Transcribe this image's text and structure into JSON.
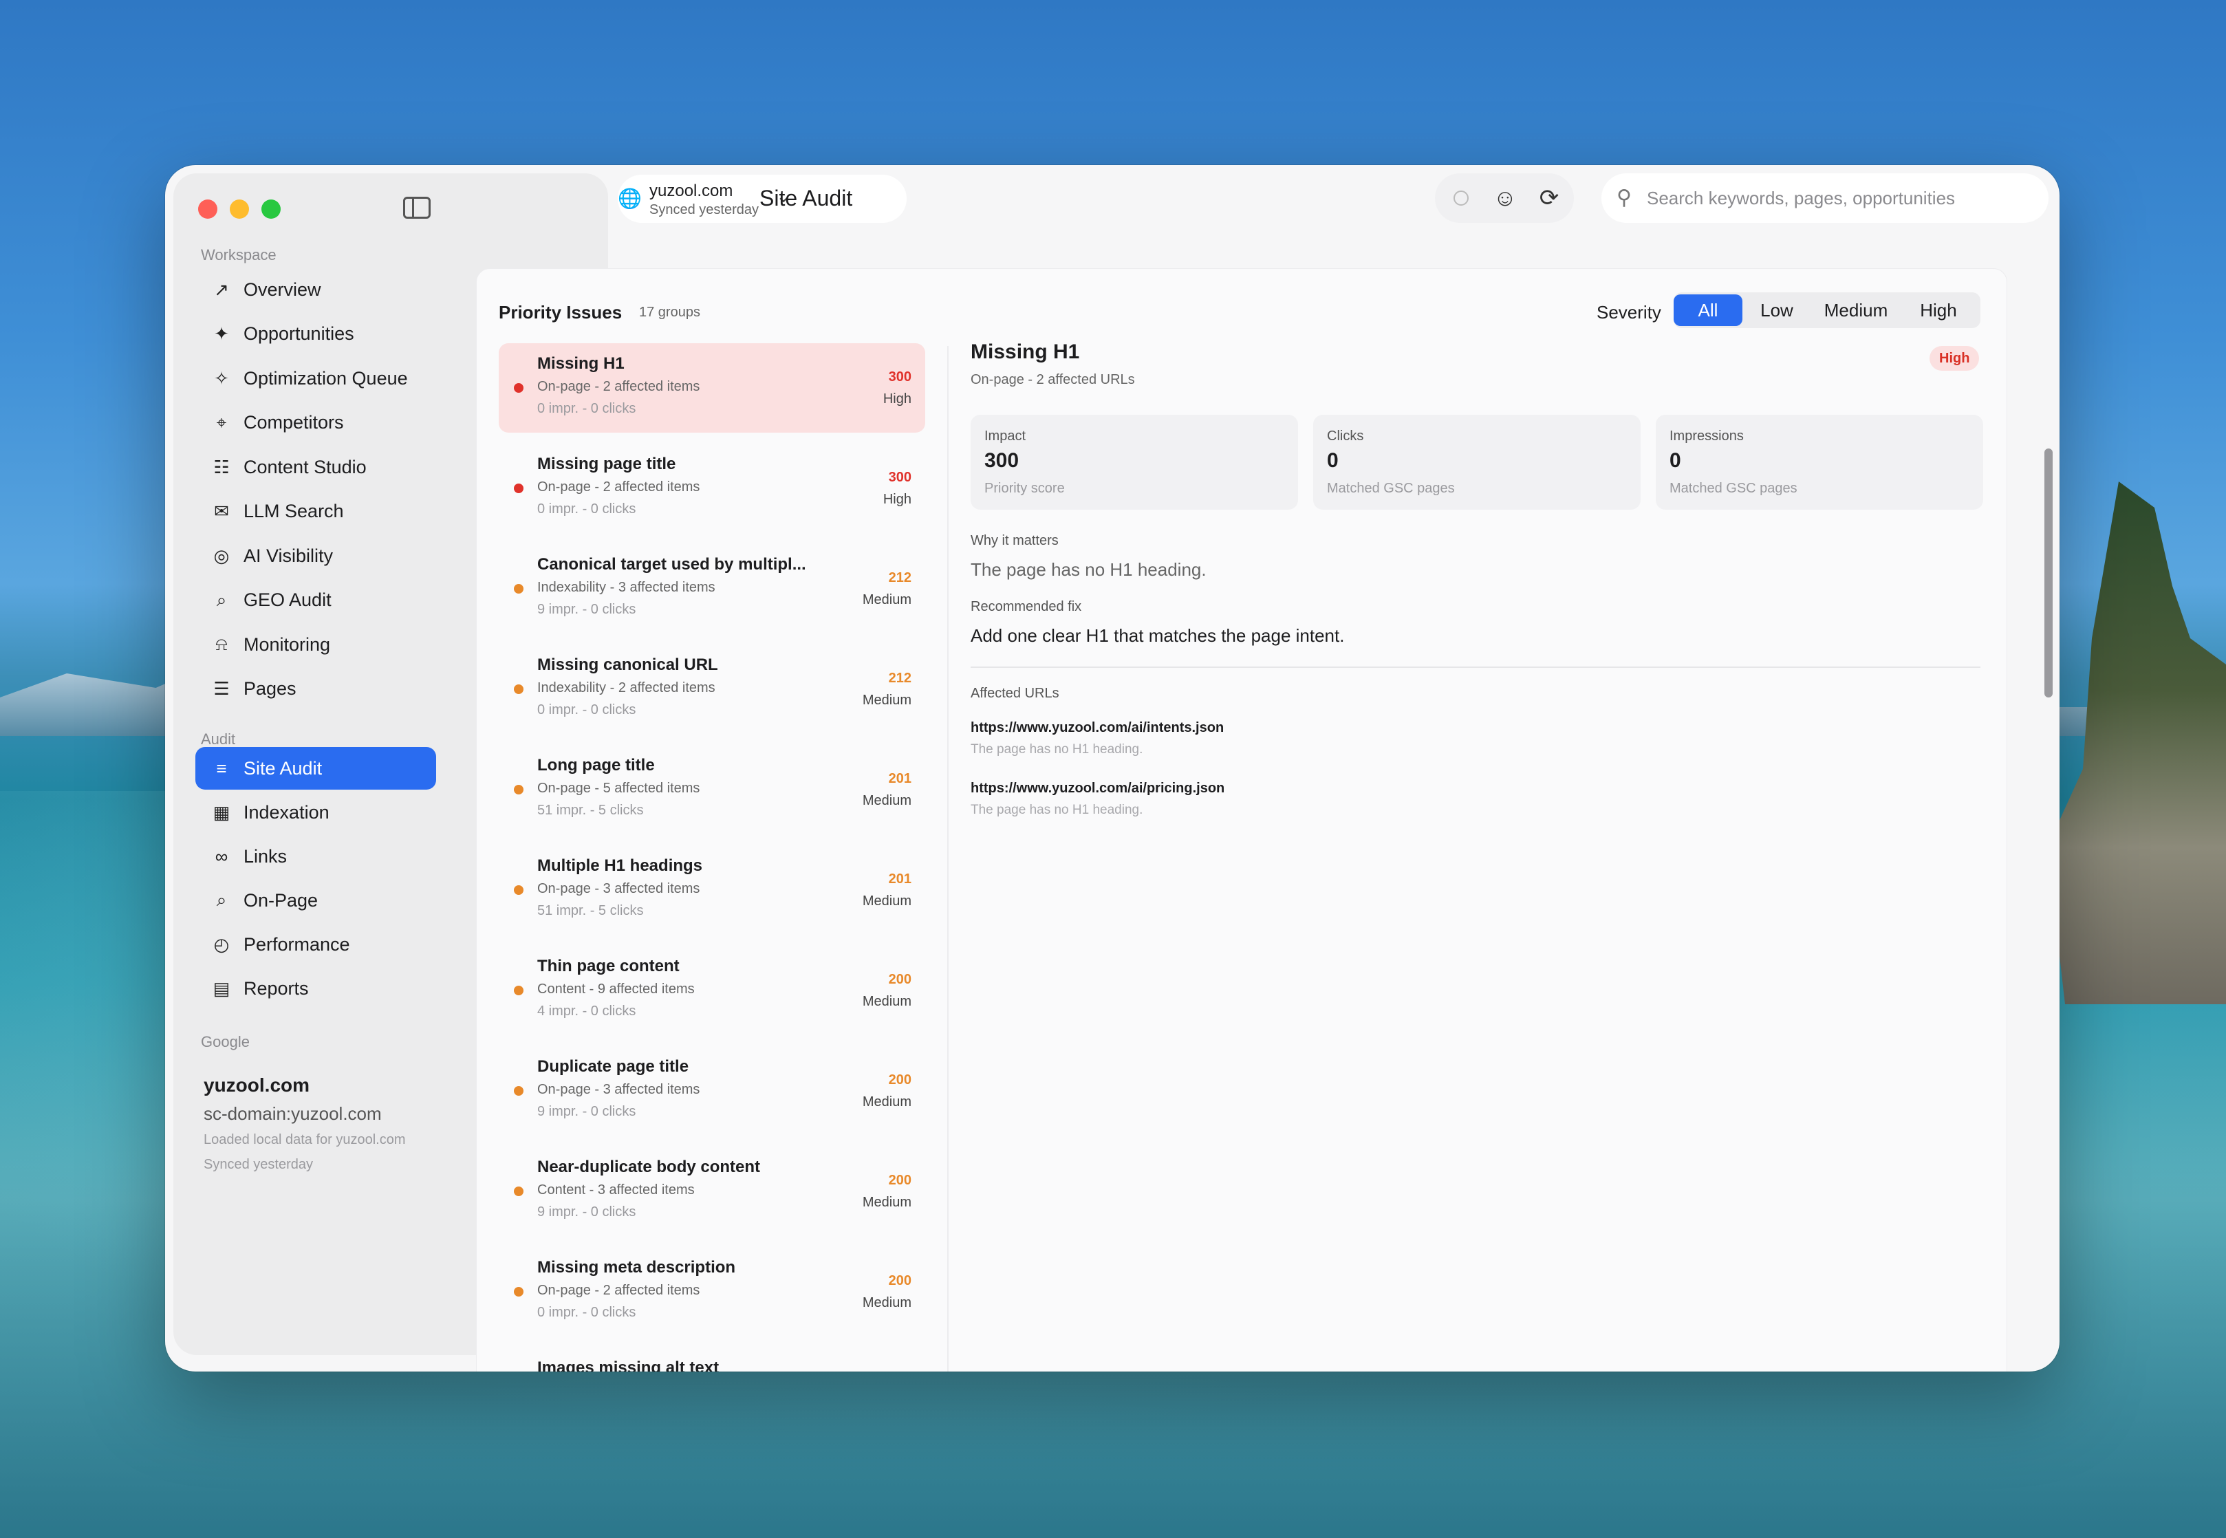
{
  "app": {
    "page_title": "Site Audit",
    "site": {
      "name": "yuzool.com",
      "sync": "Synced yesterday"
    },
    "search_placeholder": "Search keywords, pages, opportunities"
  },
  "sidebar": {
    "workspace_label": "Workspace",
    "workspace_items": [
      {
        "label": "Overview",
        "icon": "chart-icon"
      },
      {
        "label": "Opportunities",
        "icon": "sparkle-icon"
      },
      {
        "label": "Optimization Queue",
        "icon": "wand-icon"
      },
      {
        "label": "Competitors",
        "icon": "target-icon"
      },
      {
        "label": "Content Studio",
        "icon": "document-icon"
      },
      {
        "label": "LLM Search",
        "icon": "chat-icon"
      },
      {
        "label": "AI Visibility",
        "icon": "radar-icon"
      },
      {
        "label": "GEO Audit",
        "icon": "magnify-icon"
      },
      {
        "label": "Monitoring",
        "icon": "bell-icon"
      },
      {
        "label": "Pages",
        "icon": "page-icon"
      }
    ],
    "audit_label": "Audit",
    "audit_items": [
      {
        "label": "Site Audit",
        "icon": "checklist-icon",
        "active": true
      },
      {
        "label": "Indexation",
        "icon": "map-icon"
      },
      {
        "label": "Links",
        "icon": "link-icon"
      },
      {
        "label": "On-Page",
        "icon": "magnify-icon"
      },
      {
        "label": "Performance",
        "icon": "gauge-icon"
      },
      {
        "label": "Reports",
        "icon": "report-icon"
      }
    ],
    "google_label": "Google",
    "google": {
      "domain": "yuzool.com",
      "property": "sc-domain:yuzool.com",
      "note1": "Loaded local data for yuzool.com",
      "note2": "Synced yesterday"
    }
  },
  "priority": {
    "title": "Priority Issues",
    "groups": "17 groups",
    "severity_label": "Severity",
    "severity_options": [
      "All",
      "Low",
      "Medium",
      "High"
    ],
    "selected_option": "All",
    "issues": [
      {
        "title": "Missing H1",
        "meta": "On-page - 2 affected items",
        "stats": "0 impr. - 0 clicks",
        "score": "300",
        "severity": "High",
        "color": "#e0322b"
      },
      {
        "title": "Missing page title",
        "meta": "On-page - 2 affected items",
        "stats": "0 impr. - 0 clicks",
        "score": "300",
        "severity": "High",
        "color": "#e0322b"
      },
      {
        "title": "Canonical target used by multipl...",
        "meta": "Indexability - 3 affected items",
        "stats": "9 impr. - 0 clicks",
        "score": "212",
        "severity": "Medium",
        "color": "#e8892a"
      },
      {
        "title": "Missing canonical URL",
        "meta": "Indexability - 2 affected items",
        "stats": "0 impr. - 0 clicks",
        "score": "212",
        "severity": "Medium",
        "color": "#e8892a"
      },
      {
        "title": "Long page title",
        "meta": "On-page - 5 affected items",
        "stats": "51 impr. - 5 clicks",
        "score": "201",
        "severity": "Medium",
        "color": "#e8892a"
      },
      {
        "title": "Multiple H1 headings",
        "meta": "On-page - 3 affected items",
        "stats": "51 impr. - 5 clicks",
        "score": "201",
        "severity": "Medium",
        "color": "#e8892a"
      },
      {
        "title": "Thin page content",
        "meta": "Content - 9 affected items",
        "stats": "4 impr. - 0 clicks",
        "score": "200",
        "severity": "Medium",
        "color": "#e8892a"
      },
      {
        "title": "Duplicate page title",
        "meta": "On-page - 3 affected items",
        "stats": "9 impr. - 0 clicks",
        "score": "200",
        "severity": "Medium",
        "color": "#e8892a"
      },
      {
        "title": "Near-duplicate body content",
        "meta": "Content - 3 affected items",
        "stats": "9 impr. - 0 clicks",
        "score": "200",
        "severity": "Medium",
        "color": "#e8892a"
      },
      {
        "title": "Missing meta description",
        "meta": "On-page - 2 affected items",
        "stats": "0 impr. - 0 clicks",
        "score": "200",
        "severity": "Medium",
        "color": "#e8892a"
      },
      {
        "title": "Images missing alt text",
        "meta": "",
        "stats": "",
        "score": "",
        "severity": "",
        "color": "#e8892a"
      }
    ]
  },
  "detail": {
    "title": "Missing H1",
    "subtitle": "On-page - 2 affected URLs",
    "badge": "High",
    "stats": [
      {
        "label": "Impact",
        "value": "300",
        "hint": "Priority score"
      },
      {
        "label": "Clicks",
        "value": "0",
        "hint": "Matched GSC pages"
      },
      {
        "label": "Impressions",
        "value": "0",
        "hint": "Matched GSC pages"
      }
    ],
    "why_label": "Why it matters",
    "why": "The page has no H1 heading.",
    "fix_label": "Recommended fix",
    "fix": "Add one clear H1 that matches the page intent.",
    "affected_label": "Affected URLs",
    "urls": [
      {
        "url": "https://www.yuzool.com/ai/intents.json",
        "note": "The page has no H1 heading."
      },
      {
        "url": "https://www.yuzool.com/ai/pricing.json",
        "note": "The page has no H1 heading."
      }
    ]
  }
}
